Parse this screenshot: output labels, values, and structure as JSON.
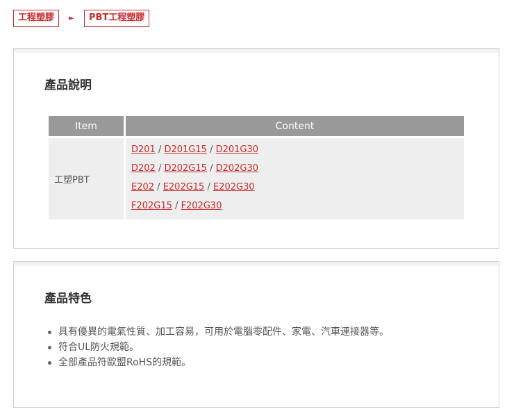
{
  "breadcrumb": {
    "items": [
      "工程塑膠",
      "PBT工程塑膠"
    ],
    "separator": "►"
  },
  "description": {
    "title": "產品說明",
    "table": {
      "headers": [
        "Item",
        "Content"
      ],
      "rows": [
        {
          "item": "工塑PBT",
          "lines": [
            [
              "D201",
              "D201G15",
              "D201G30"
            ],
            [
              "D202",
              "D202G15",
              "D202G30"
            ],
            [
              "E202",
              "E202G15",
              "E202G30"
            ],
            [
              "F202G15",
              "F202G30"
            ]
          ]
        }
      ]
    }
  },
  "features": {
    "title": "產品特色",
    "items": [
      "具有優異的電氣性質、加工容易，可用於電腦零配件、家電、汽車連接器等。",
      "符合UL防火規範。",
      "全部產品符歐盟RoHS的規範。"
    ]
  },
  "colors": {
    "accent": "#cc2a2a",
    "table_header_bg": "#999999",
    "table_cell_bg": "#eeeeee",
    "panel_border": "#d0d0d0"
  }
}
